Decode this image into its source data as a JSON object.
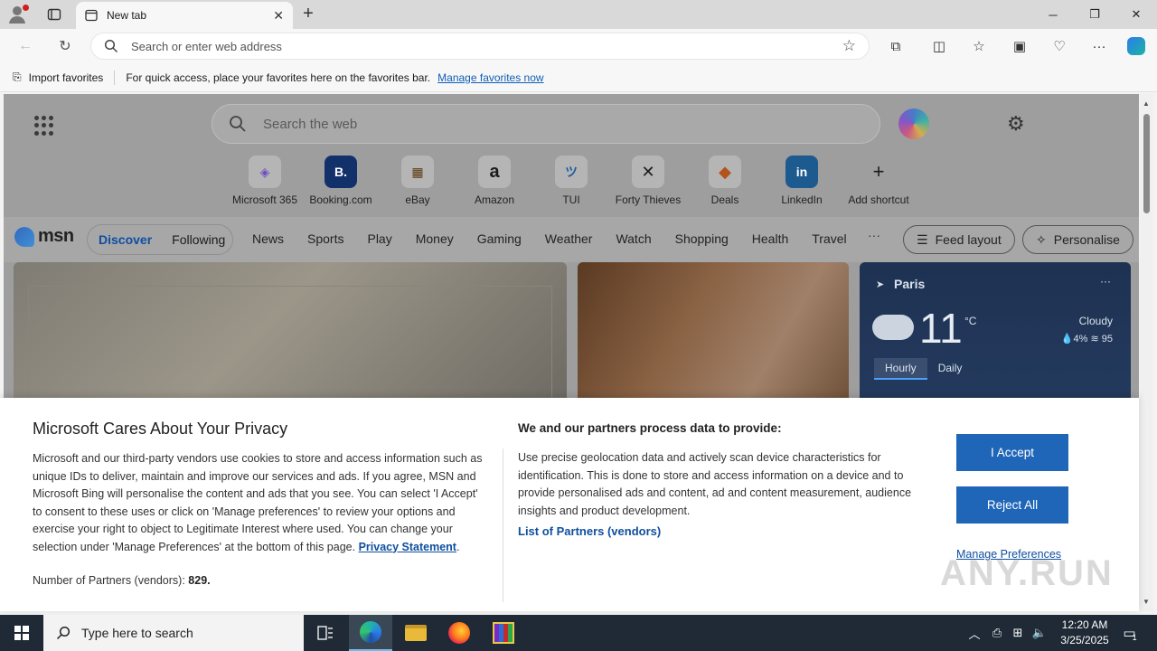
{
  "browser": {
    "tab_title": "New tab",
    "address_placeholder": "Search or enter web address"
  },
  "favorites_bar": {
    "import_label": "Import favorites",
    "hint": "For quick access, place your favorites here on the favorites bar.",
    "manage_link": "Manage favorites now"
  },
  "msn": {
    "search_placeholder": "Search the web",
    "shortcuts": [
      {
        "label": "Microsoft 365",
        "glyph": "◈"
      },
      {
        "label": "Booking.com",
        "glyph": "B."
      },
      {
        "label": "eBay",
        "glyph": "▦"
      },
      {
        "label": "Amazon",
        "glyph": "a"
      },
      {
        "label": "TUI",
        "glyph": "ツ"
      },
      {
        "label": "Forty Thieves",
        "glyph": "✕"
      },
      {
        "label": "Deals",
        "glyph": "◆"
      },
      {
        "label": "LinkedIn",
        "glyph": "in"
      },
      {
        "label": "Add shortcut",
        "glyph": "+"
      }
    ],
    "logo_text": "msn",
    "feed_tabs": [
      "Discover",
      "Following"
    ],
    "nav": [
      "News",
      "Sports",
      "Play",
      "Money",
      "Gaming",
      "Weather",
      "Watch",
      "Shopping",
      "Health",
      "Travel"
    ],
    "more": "···",
    "feed_layout": "Feed layout",
    "personalise": "Personalise",
    "weather": {
      "city": "Paris",
      "temp": "11",
      "unit": "°C",
      "condition": "Cloudy",
      "stats": "💧4%  ≋ 95",
      "tabs": [
        "Hourly",
        "Daily"
      ]
    }
  },
  "privacy": {
    "title": "Microsoft Cares About Your Privacy",
    "body": "Microsoft and our third-party vendors use cookies to store and access information such as unique IDs to deliver, maintain and improve our services and ads. If you agree, MSN and Microsoft Bing will personalise the content and ads that you see. You can select 'I Accept' to consent to these uses or click on 'Manage preferences' to review your options and exercise your right to object to Legitimate Interest where used.  You can change your selection under 'Manage Preferences' at the bottom of this page.",
    "privacy_link": "Privacy Statement",
    "partners_label": "Number of Partners (vendors):",
    "partners_count": "829.",
    "right_title": "We and our partners process data to provide:",
    "right_body": "Use precise geolocation data and actively scan device characteristics for identification. This is done to store and access information on a device and to provide personalised ads and content, ad and content measurement, audience insights and product development.",
    "list_link": "List of Partners (vendors)",
    "accept": "I Accept",
    "reject": "Reject All",
    "manage": "Manage Preferences",
    "watermark": "ANY.RUN"
  },
  "taskbar": {
    "search_placeholder": "Type here to search",
    "time": "12:20 AM",
    "date": "3/25/2025",
    "notification_count": "1"
  }
}
